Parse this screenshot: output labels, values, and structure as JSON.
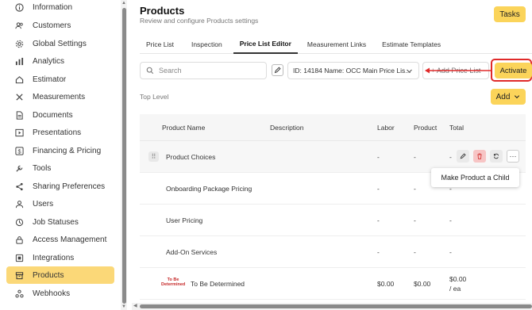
{
  "sidebar": {
    "items": [
      {
        "label": "Information",
        "icon": "info-icon"
      },
      {
        "label": "Customers",
        "icon": "users-icon"
      },
      {
        "label": "Global Settings",
        "icon": "gear-icon"
      },
      {
        "label": "Analytics",
        "icon": "chart-icon"
      },
      {
        "label": "Estimator",
        "icon": "home-icon"
      },
      {
        "label": "Measurements",
        "icon": "ruler-icon"
      },
      {
        "label": "Documents",
        "icon": "document-icon"
      },
      {
        "label": "Presentations",
        "icon": "presentation-icon"
      },
      {
        "label": "Financing & Pricing",
        "icon": "dollar-icon"
      },
      {
        "label": "Tools",
        "icon": "tools-icon"
      },
      {
        "label": "Sharing Preferences",
        "icon": "share-icon"
      },
      {
        "label": "Users",
        "icon": "user-icon"
      },
      {
        "label": "Job Statuses",
        "icon": "status-icon"
      },
      {
        "label": "Access Management",
        "icon": "lock-icon"
      },
      {
        "label": "Integrations",
        "icon": "integrations-icon"
      },
      {
        "label": "Products",
        "icon": "box-icon",
        "active": true
      },
      {
        "label": "Webhooks",
        "icon": "webhook-icon"
      }
    ]
  },
  "header": {
    "title": "Products",
    "subtitle": "Review and configure Products settings",
    "tasks_label": "Tasks"
  },
  "tabs": [
    {
      "label": "Price List"
    },
    {
      "label": "Inspection"
    },
    {
      "label": "Price List Editor",
      "active": true
    },
    {
      "label": "Measurement Links"
    },
    {
      "label": "Estimate Templates"
    }
  ],
  "toolbar": {
    "search_placeholder": "Search",
    "price_list_selected": "ID: 14184 Name: OCC Main Price Lis...",
    "add_price_list_label": "+ Add Price List",
    "activate_label": "Activate"
  },
  "top_level_label": "Top Level",
  "add_label": "Add",
  "table": {
    "columns": [
      "Product Name",
      "Description",
      "Labor",
      "Product",
      "Total"
    ],
    "rows": [
      {
        "name": "Product Choices",
        "labor": "-",
        "product": "-",
        "total": "-"
      },
      {
        "name": "Onboarding Package Pricing",
        "labor": "-",
        "product": "-",
        "total": "-"
      },
      {
        "name": "User Pricing",
        "labor": "-",
        "product": "-",
        "total": "-"
      },
      {
        "name": "Add-On Services",
        "labor": "-",
        "product": "-",
        "total": "-"
      },
      {
        "name": "To Be Determined",
        "logo_text": "To Be Determined",
        "labor": "$0.00",
        "product": "$0.00",
        "total": "$0.00",
        "total_unit": "/ ea"
      }
    ]
  },
  "tooltip": {
    "label": "Make Product a Child"
  },
  "colors": {
    "accent": "#fbd45a",
    "active_nav": "#fbd878",
    "highlight": "#e02a2a",
    "delete": "#f7c5c5"
  }
}
